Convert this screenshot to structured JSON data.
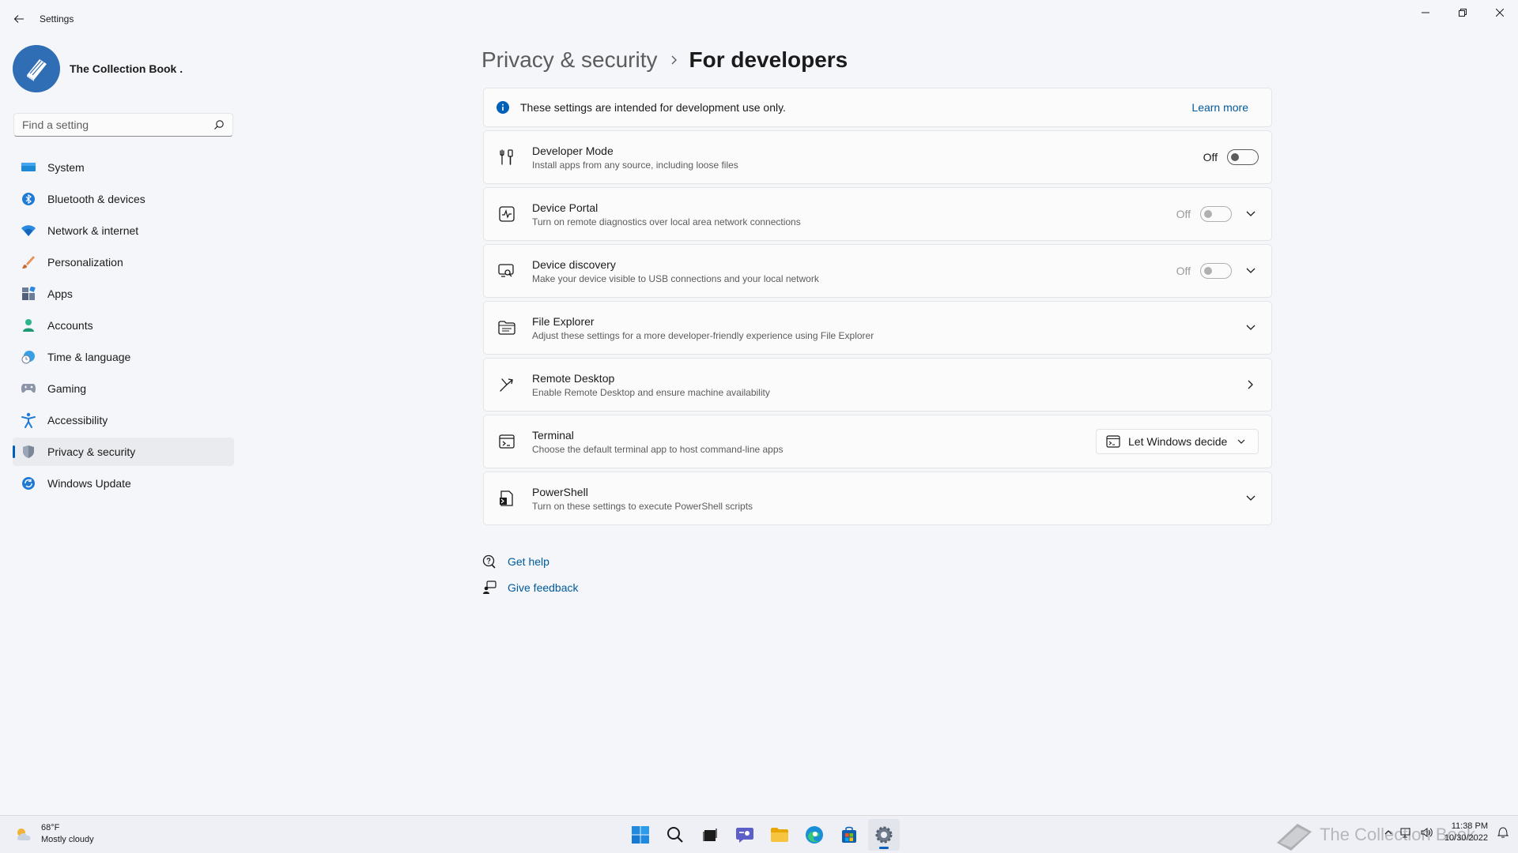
{
  "window": {
    "title": "Settings"
  },
  "profile": {
    "name": "The Collection Book ."
  },
  "search": {
    "placeholder": "Find a setting"
  },
  "sidebar": {
    "items": [
      {
        "label": "System",
        "icon": "monitor-icon",
        "active": false
      },
      {
        "label": "Bluetooth & devices",
        "icon": "bluetooth-icon",
        "active": false
      },
      {
        "label": "Network & internet",
        "icon": "wifi-icon",
        "active": false
      },
      {
        "label": "Personalization",
        "icon": "brush-icon",
        "active": false
      },
      {
        "label": "Apps",
        "icon": "apps-icon",
        "active": false
      },
      {
        "label": "Accounts",
        "icon": "person-icon",
        "active": false
      },
      {
        "label": "Time & language",
        "icon": "globe-clock-icon",
        "active": false
      },
      {
        "label": "Gaming",
        "icon": "gamepad-icon",
        "active": false
      },
      {
        "label": "Accessibility",
        "icon": "accessibility-icon",
        "active": false
      },
      {
        "label": "Privacy & security",
        "icon": "shield-icon",
        "active": true
      },
      {
        "label": "Windows Update",
        "icon": "refresh-icon",
        "active": false
      }
    ]
  },
  "breadcrumb": {
    "parent": "Privacy & security",
    "current": "For developers"
  },
  "info_bar": {
    "text": "These settings are intended for development use only.",
    "link": "Learn more"
  },
  "settings": {
    "developer_mode": {
      "title": "Developer Mode",
      "desc": "Install apps from any source, including loose files",
      "state": "Off"
    },
    "device_portal": {
      "title": "Device Portal",
      "desc": "Turn on remote diagnostics over local area network connections",
      "state": "Off"
    },
    "device_discovery": {
      "title": "Device discovery",
      "desc": "Make your device visible to USB connections and your local network",
      "state": "Off"
    },
    "file_explorer": {
      "title": "File Explorer",
      "desc": "Adjust these settings for a more developer-friendly experience using File Explorer"
    },
    "remote_desktop": {
      "title": "Remote Desktop",
      "desc": "Enable Remote Desktop and ensure machine availability"
    },
    "terminal": {
      "title": "Terminal",
      "desc": "Choose the default terminal app to host command-line apps",
      "selected": "Let Windows decide"
    },
    "powershell": {
      "title": "PowerShell",
      "desc": "Turn on these settings to execute PowerShell scripts"
    }
  },
  "help": {
    "get_help": "Get help",
    "give_feedback": "Give feedback"
  },
  "taskbar": {
    "weather_temp": "68°F",
    "weather_desc": "Mostly cloudy",
    "time": "11:38 PM",
    "date": "10/30/2022",
    "watermark": "The Collection Book",
    "accent": "#005fb8"
  }
}
